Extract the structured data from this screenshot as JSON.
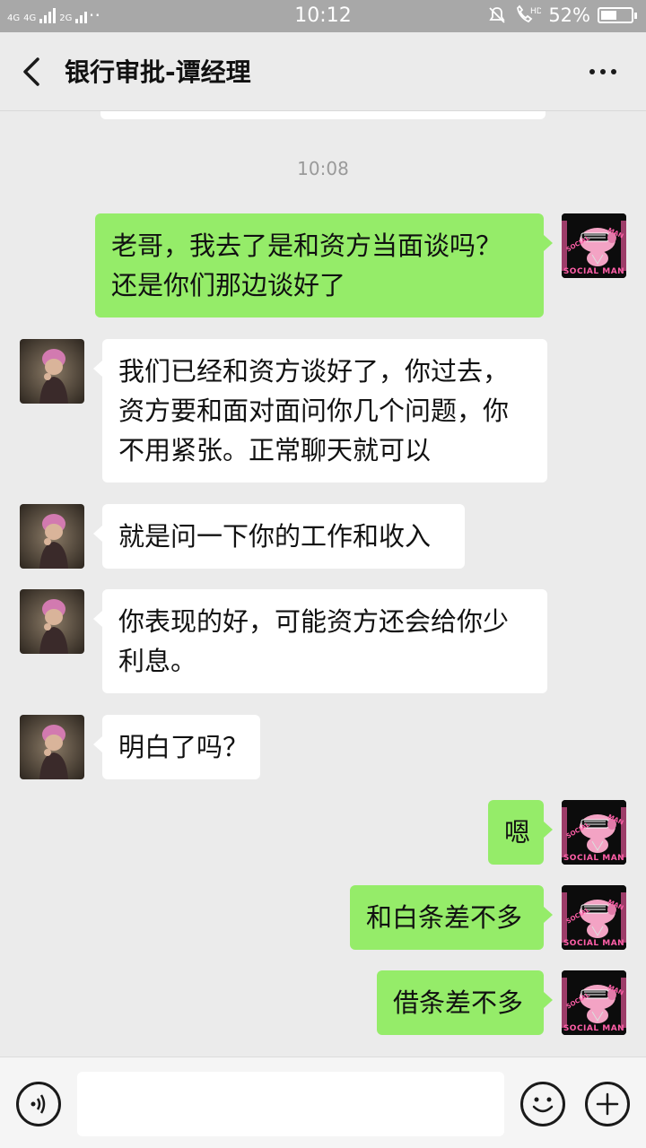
{
  "status_bar": {
    "network_1": "4G",
    "network_2": "4G",
    "network_3": "2G",
    "time": "10:12",
    "battery": "52%",
    "battery_level": 0.52
  },
  "header": {
    "title": "银行审批-谭经理"
  },
  "chat": {
    "timestamp": "10:08",
    "messages": [
      {
        "side": "right",
        "lines": [
          "老哥，我去了是和资方当面谈吗？",
          "还是你们那边谈好了"
        ]
      },
      {
        "side": "left",
        "lines": [
          "我们已经和资方谈好了，你过去，",
          "资方要和面对面问你几个问题，你",
          "不用紧张。正常聊天就可以"
        ]
      },
      {
        "side": "left",
        "lines": [
          "就是问一下你的工作和收入"
        ]
      },
      {
        "side": "left",
        "lines": [
          "你表现的好，可能资方还会给你少",
          "利息。"
        ]
      },
      {
        "side": "left",
        "lines": [
          "明白了吗？"
        ]
      },
      {
        "side": "right",
        "lines": [
          "嗯"
        ]
      },
      {
        "side": "right",
        "lines": [
          "和白条差不多"
        ]
      },
      {
        "side": "right",
        "lines": [
          "借条差不多"
        ]
      }
    ]
  },
  "avatars": {
    "self_label": "SOCIAL MAN",
    "self_label_small_1": "SOCIAL",
    "self_label_small_2": "MAN"
  },
  "colors": {
    "accent_green": "#95ec69",
    "background": "#ebebeb",
    "status_bar": "#a8a8a8"
  },
  "icons": {
    "back": "chevron-left-icon",
    "more": "more-dots-icon",
    "voice": "voice-icon",
    "emoji": "emoji-icon",
    "plus": "plus-icon"
  }
}
